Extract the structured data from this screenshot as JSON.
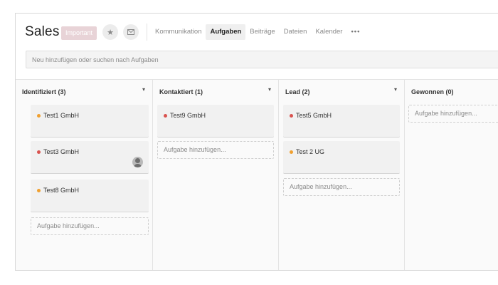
{
  "header": {
    "title": "Sales",
    "badge": "Important",
    "star_icon": "star-icon",
    "mail_icon": "mail-icon",
    "tabs": [
      {
        "label": "Kommunikation",
        "active": false
      },
      {
        "label": "Aufgaben",
        "active": true
      },
      {
        "label": "Beiträge",
        "active": false
      },
      {
        "label": "Dateien",
        "active": false
      },
      {
        "label": "Kalender",
        "active": false
      },
      {
        "label": "•••",
        "active": false
      }
    ]
  },
  "search": {
    "placeholder": "Neu hinzufügen oder suchen nach Aufgaben"
  },
  "colors": {
    "dot_orange": "#f0a030",
    "dot_red": "#d9534f",
    "badge_bg": "#e8d3d7"
  },
  "columns": [
    {
      "title": "Identifiziert (3)",
      "cards": [
        {
          "name": "Test1 GmbH",
          "dot": "orange"
        },
        {
          "name": "Test3 GmbH",
          "dot": "red",
          "avatar": true
        },
        {
          "name": "Test8 GmbH",
          "dot": "orange"
        }
      ],
      "add_label": "Aufgabe hinzufügen..."
    },
    {
      "title": "Kontaktiert (1)",
      "cards": [
        {
          "name": "Test9 GmbH",
          "dot": "red"
        }
      ],
      "add_label": "Aufgabe hinzufügen..."
    },
    {
      "title": "Lead (2)",
      "cards": [
        {
          "name": "Test5 GmbH",
          "dot": "red"
        },
        {
          "name": "Test 2 UG",
          "dot": "orange"
        }
      ],
      "add_label": "Aufgabe hinzufügen..."
    },
    {
      "title": "Gewonnen (0)",
      "cards": [],
      "add_label": "Aufgabe hinzufügen..."
    }
  ]
}
